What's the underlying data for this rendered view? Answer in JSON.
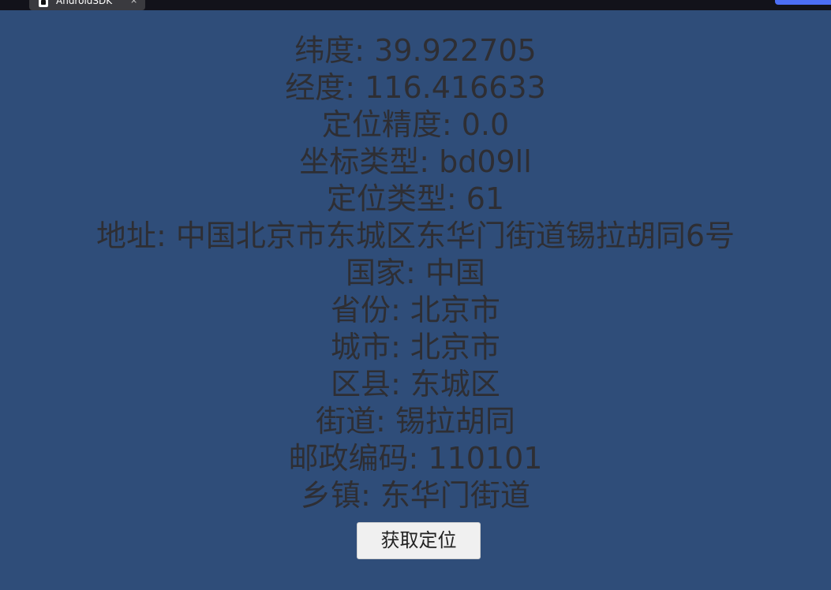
{
  "window": {
    "tab_title": "AndroidSDK",
    "tab_close": "×",
    "corner_badge_text": "",
    "colors": {
      "background": "#2f4d79",
      "text": "#2e2e33",
      "topbar": "#12121a",
      "badge": "#4c6ef5"
    }
  },
  "location_info": [
    {
      "label": "纬度",
      "value": "39.922705",
      "text": "纬度: 39.922705"
    },
    {
      "label": "经度",
      "value": "116.416633",
      "text": "经度: 116.416633"
    },
    {
      "label": "定位精度",
      "value": "0.0",
      "text": "定位精度: 0.0"
    },
    {
      "label": "坐标类型",
      "value": "bd09ll",
      "text": "坐标类型: bd09ll"
    },
    {
      "label": "定位类型",
      "value": "61",
      "text": "定位类型: 61"
    },
    {
      "label": "地址",
      "value": "中国北京市东城区东华门街道锡拉胡同6号",
      "text": "地址: 中国北京市东城区东华门街道锡拉胡同6号"
    },
    {
      "label": "国家",
      "value": "中国",
      "text": "国家: 中国"
    },
    {
      "label": "省份",
      "value": "北京市",
      "text": "省份: 北京市"
    },
    {
      "label": "城市",
      "value": "北京市",
      "text": "城市: 北京市"
    },
    {
      "label": "区县",
      "value": "东城区",
      "text": "区县: 东城区"
    },
    {
      "label": "街道",
      "value": "锡拉胡同",
      "text": "街道: 锡拉胡同"
    },
    {
      "label": "邮政编码",
      "value": "110101",
      "text": "邮政编码: 110101"
    },
    {
      "label": "乡镇",
      "value": "东华门街道",
      "text": "乡镇: 东华门街道"
    }
  ],
  "actions": {
    "get_location_label": "获取定位"
  }
}
